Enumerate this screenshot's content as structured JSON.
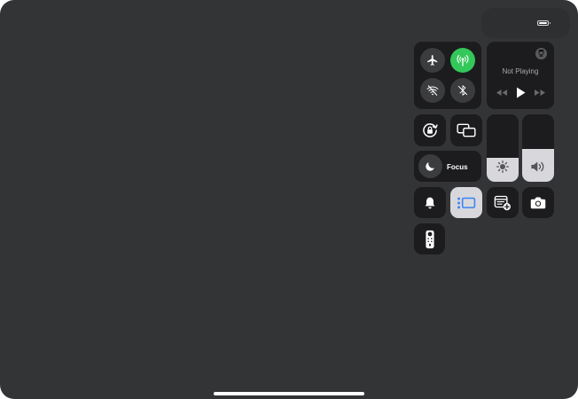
{
  "status_bar": {
    "battery_icon": "battery-full-icon"
  },
  "connectivity": {
    "airplane_icon": "airplane-icon",
    "cellular_icon": "cellular-data-icon",
    "cellular_color": "#34c759",
    "wifi_icon": "wifi-off-icon",
    "bluetooth_icon": "bluetooth-off-icon"
  },
  "now_playing": {
    "title": "Not Playing",
    "airplay_icon": "airplay-icon",
    "controls": [
      "rewind-icon",
      "play-icon",
      "fast-forward-icon"
    ]
  },
  "controls": {
    "orientation_lock_icon": "orientation-lock-icon",
    "screen_mirroring_icon": "screen-mirroring-icon",
    "focus_label": "Focus",
    "focus_icon": "moon-icon",
    "silent_icon": "bell-icon",
    "stage_manager_icon": "stage-manager-icon",
    "stage_manager_active": true,
    "quick_note_icon": "quick-note-icon",
    "camera_icon": "camera-icon",
    "remote_icon": "apple-tv-remote-icon"
  },
  "sliders": {
    "brightness": {
      "icon": "sun-icon",
      "level": 0.36
    },
    "volume": {
      "icon": "speaker-icon",
      "level": 0.49
    }
  },
  "colors": {
    "background": "#333436",
    "tile": "#1c1c1e",
    "accent_blue": "#3a82f7",
    "active_tile": "#d8d8dc"
  }
}
